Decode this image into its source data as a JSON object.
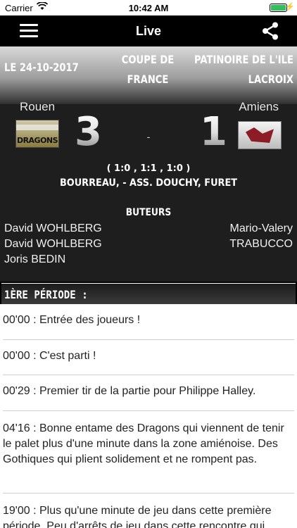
{
  "status_bar": {
    "carrier": "Carrier",
    "time": "10:42 AM",
    "battery_color": "#2fc15a",
    "battery_level": 1.0
  },
  "navbar": {
    "title": "Live",
    "menu_icon": "hamburger-icon",
    "share_icon": "share-icon"
  },
  "match": {
    "date": "LE 24-10-2017",
    "competition_line1": "COUPE DE",
    "competition_line2": "FRANCE",
    "venue_line1": "PATINOIRE DE L'ILE",
    "venue_line2": "LACROIX",
    "home_team": "Rouen",
    "away_team": "Amiens",
    "home_logo_text": "DRAGONS",
    "home_score": "3",
    "away_score": "1",
    "score_separator": "-",
    "periods": "( 1:0 , 1:1 , 1:0 )",
    "referees": "BOURREAU, - ASS. DOUCHY, FURET",
    "scorers_title": "BUTEURS",
    "home_scorers": [
      "David WOHLBERG",
      "David WOHLBERG",
      "Joris BEDIN"
    ],
    "away_scorers": [
      "Mario-Valery",
      "TRABUCCO"
    ]
  },
  "period_header": "1ÈRE PÉRIODE :",
  "feed": [
    {
      "time": "00'00",
      "text": " : Entrée des joueurs !"
    },
    {
      "time": "00'00",
      "text": " : C'est parti !"
    },
    {
      "time": "00'29",
      "text": " : Premier tir de la partie pour Philippe Halley."
    },
    {
      "time": "04'16",
      "text": " : Bonne entame des Dragons qui viennent de tenir le palet plus d'une minute dans la zone amiénoise. Des Gothiques qui plient solidement et ne rompent pas."
    },
    {
      "time": "19'00",
      "text": " : Plus qu'une minute de jeu dans cette première période. Peu d'arrêts de jeu dans cette rencontre qui"
    }
  ]
}
